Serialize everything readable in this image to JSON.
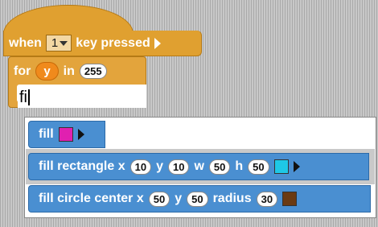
{
  "hat_block": {
    "label_when": "when",
    "key_value": "1",
    "label_key_pressed": "key pressed"
  },
  "for_block": {
    "label_for": "for",
    "variable": "y",
    "label_in": "in",
    "range_end": "255"
  },
  "search": {
    "value": "fi"
  },
  "suggestions": [
    {
      "label": "fill",
      "swatch_color": "#e020b0"
    },
    {
      "label_main": "fill rectangle x",
      "x": "10",
      "label_y": "y",
      "y": "10",
      "label_w": "w",
      "w": "50",
      "label_h": "h",
      "h": "50",
      "swatch_color": "#1ec8e6"
    },
    {
      "label_main": "fill circle center x",
      "x": "50",
      "label_y": "y",
      "y": "50",
      "label_radius": "radius",
      "radius": "30",
      "swatch_color": "#6a3a12"
    }
  ],
  "colors": {
    "control_block": "#e0a030",
    "command_block": "#4a8fd1",
    "variable_block": "#f08a1c"
  }
}
